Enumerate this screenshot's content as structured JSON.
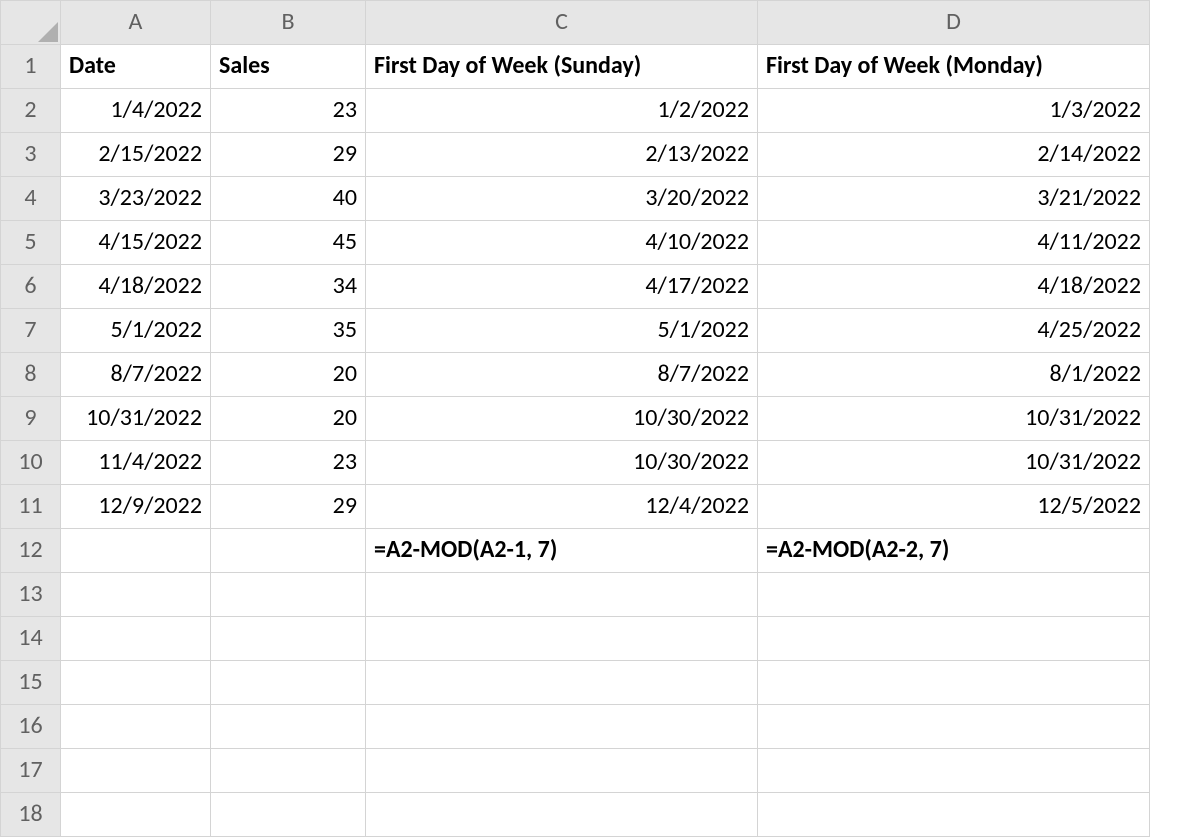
{
  "columns": [
    "A",
    "B",
    "C",
    "D"
  ],
  "rowCount": 18,
  "headerRow": {
    "A": "Date",
    "B": "Sales",
    "C": "First Day of Week (Sunday)",
    "D": "First Day of Week (Monday)"
  },
  "data": [
    {
      "A": "1/4/2022",
      "B": "23",
      "C": "1/2/2022",
      "D": "1/3/2022"
    },
    {
      "A": "2/15/2022",
      "B": "29",
      "C": "2/13/2022",
      "D": "2/14/2022"
    },
    {
      "A": "3/23/2022",
      "B": "40",
      "C": "3/20/2022",
      "D": "3/21/2022"
    },
    {
      "A": "4/15/2022",
      "B": "45",
      "C": "4/10/2022",
      "D": "4/11/2022"
    },
    {
      "A": "4/18/2022",
      "B": "34",
      "C": "4/17/2022",
      "D": "4/18/2022"
    },
    {
      "A": "5/1/2022",
      "B": "35",
      "C": "5/1/2022",
      "D": "4/25/2022"
    },
    {
      "A": "8/7/2022",
      "B": "20",
      "C": "8/7/2022",
      "D": "8/1/2022"
    },
    {
      "A": "10/31/2022",
      "B": "20",
      "C": "10/30/2022",
      "D": "10/31/2022"
    },
    {
      "A": "11/4/2022",
      "B": "23",
      "C": "10/30/2022",
      "D": "10/31/2022"
    },
    {
      "A": "12/9/2022",
      "B": "29",
      "C": "12/4/2022",
      "D": "12/5/2022"
    }
  ],
  "formulaRow": {
    "C": "=A2-MOD(A2-1, 7)",
    "D": "=A2-MOD(A2-2, 7)"
  }
}
